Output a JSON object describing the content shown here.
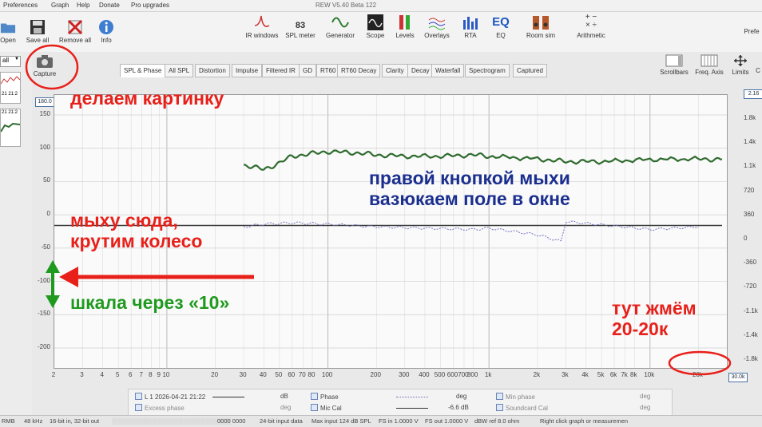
{
  "window_title": "REW V5.40 Beta 122",
  "menu": [
    "Preferences",
    "Graph",
    "Help",
    "Donate",
    "Pro upgrades"
  ],
  "toolbar_left": [
    {
      "label": "Open",
      "icon": "folder-icon"
    },
    {
      "label": "Save all",
      "icon": "save-icon"
    },
    {
      "label": "Remove all",
      "icon": "remove-icon"
    },
    {
      "label": "Info",
      "icon": "info-icon"
    }
  ],
  "capture_label": "Capture",
  "toolbar_center": [
    {
      "label": "IR windows",
      "icon": "ir-windows-icon"
    },
    {
      "label": "SPL meter",
      "icon": "spl-meter-icon",
      "value": "83",
      "unit": "dB SPL"
    },
    {
      "label": "Generator",
      "icon": "generator-icon"
    },
    {
      "label": "Scope",
      "icon": "scope-icon"
    },
    {
      "label": "Levels",
      "icon": "levels-icon"
    },
    {
      "label": "Overlays",
      "icon": "overlays-icon"
    },
    {
      "label": "RTA",
      "icon": "rta-icon"
    },
    {
      "label": "EQ",
      "icon": "eq-icon"
    },
    {
      "label": "Room sim",
      "icon": "room-sim-icon"
    },
    {
      "label": "Arithmetic",
      "icon": "arithmetic-icon"
    }
  ],
  "toolbar_right_label": "Prefe",
  "side_buttons": [
    "Scrollbars",
    "Freq. Axis",
    "Limits",
    "C"
  ],
  "left_panel": {
    "dropdown": "all",
    "meas_date": "21 21:2",
    "meas_date2": "21 21:2"
  },
  "tabs": [
    "SPL & Phase",
    "All SPL",
    "Distortion",
    "Impulse",
    "Filtered IR",
    "GD",
    "RT60",
    "RT60 Decay",
    "Clarity",
    "Decay",
    "Waterfall",
    "Spectrogram",
    "Captured"
  ],
  "selected_tab": "SPL & Phase",
  "y_top_box": "180.0",
  "y_right_box": "2.16",
  "x_right_box": "30.0k",
  "y_left_ticks": [
    "150",
    "100",
    "50",
    "0",
    "-50",
    "-100",
    "-150",
    "-200"
  ],
  "y_right_ticks": [
    "1.8k",
    "1.4k",
    "1.1k",
    "720",
    "360",
    "0",
    "-360",
    "-720",
    "-1.1k",
    "-1.4k",
    "-1.8k"
  ],
  "x_ticks": [
    "2",
    "3",
    "4",
    "5",
    "6",
    "7",
    "8",
    "9",
    "10",
    "20",
    "30",
    "40",
    "50",
    "60",
    "70",
    "80",
    "100",
    "200",
    "300",
    "400",
    "500",
    "600",
    "700",
    "800",
    "1k",
    "2k",
    "3k",
    "4k",
    "5k",
    "6k",
    "7k",
    "8k",
    "10k",
    "20k"
  ],
  "chart_data": {
    "type": "line",
    "xscale": "log",
    "xlim": [
      2,
      30000
    ],
    "ylim_left": [
      -230,
      180
    ],
    "ylim_right_labels": "phase deg",
    "series": [
      {
        "name": "",
        "color": "#2f6b2f",
        "x": [
          30,
          40,
          50,
          60,
          80,
          100,
          150,
          200,
          300,
          500,
          800,
          1000,
          2000,
          3000,
          5000,
          10000,
          20000,
          28000
        ],
        "y": [
          75,
          68,
          78,
          88,
          92,
          95,
          93,
          90,
          88,
          88,
          90,
          88,
          84,
          80,
          80,
          83,
          84,
          83
        ]
      },
      {
        "name": "",
        "color": "#3a3a3a",
        "x": [
          2,
          10,
          20,
          100,
          1000,
          10000,
          28000
        ],
        "y": [
          -16,
          -16,
          -16,
          -16,
          -16,
          -16,
          -16
        ]
      },
      {
        "name": "",
        "color": "#7070c0",
        "x": [
          30,
          40,
          60,
          100,
          200,
          400,
          800,
          1000,
          2000,
          2800,
          3000,
          5000,
          10000,
          20000
        ],
        "y": [
          -18,
          -14,
          -12,
          -14,
          -18,
          -20,
          -22,
          -20,
          -30,
          -40,
          -10,
          -15,
          -22,
          -18
        ]
      }
    ]
  },
  "legend": {
    "row1": [
      {
        "label": "L 1 2026-04-21 21:22",
        "unit": "dB"
      },
      {
        "label": "Phase",
        "unit": "deg"
      },
      {
        "label": "Min phase",
        "unit": "deg"
      }
    ],
    "row2": [
      {
        "label": "Excess phase",
        "unit": "deg"
      },
      {
        "label": "Mic Cal",
        "unit": "-6.6 dB"
      },
      {
        "label": "Soundcard Cal",
        "unit": "deg"
      }
    ]
  },
  "statusbar": [
    "RMB",
    "48 kHz",
    "16-bit in, 32-bit out",
    "24-bit input data",
    "Max input 124 dB SPL",
    "FS in 1.0000 V",
    "FS out 1.0000 V",
    "dBW ref 8.0 ohm",
    "Right click graph or measuremen"
  ],
  "statusbar_masked": "0000 0000",
  "annotations": [
    {
      "text": "делаем картинку",
      "color": "#e8201a"
    },
    {
      "text": "правой кнопкой мыхи\nвазюкаем поле в окне",
      "color": "#1b2f8f"
    },
    {
      "text": "мыху сюда,\nкрутим колесо",
      "color": "#e8201a"
    },
    {
      "text": "шкала через «10»",
      "color": "#1f9a1f"
    },
    {
      "text": "тут жмём\n20-20к",
      "color": "#e8201a"
    }
  ]
}
